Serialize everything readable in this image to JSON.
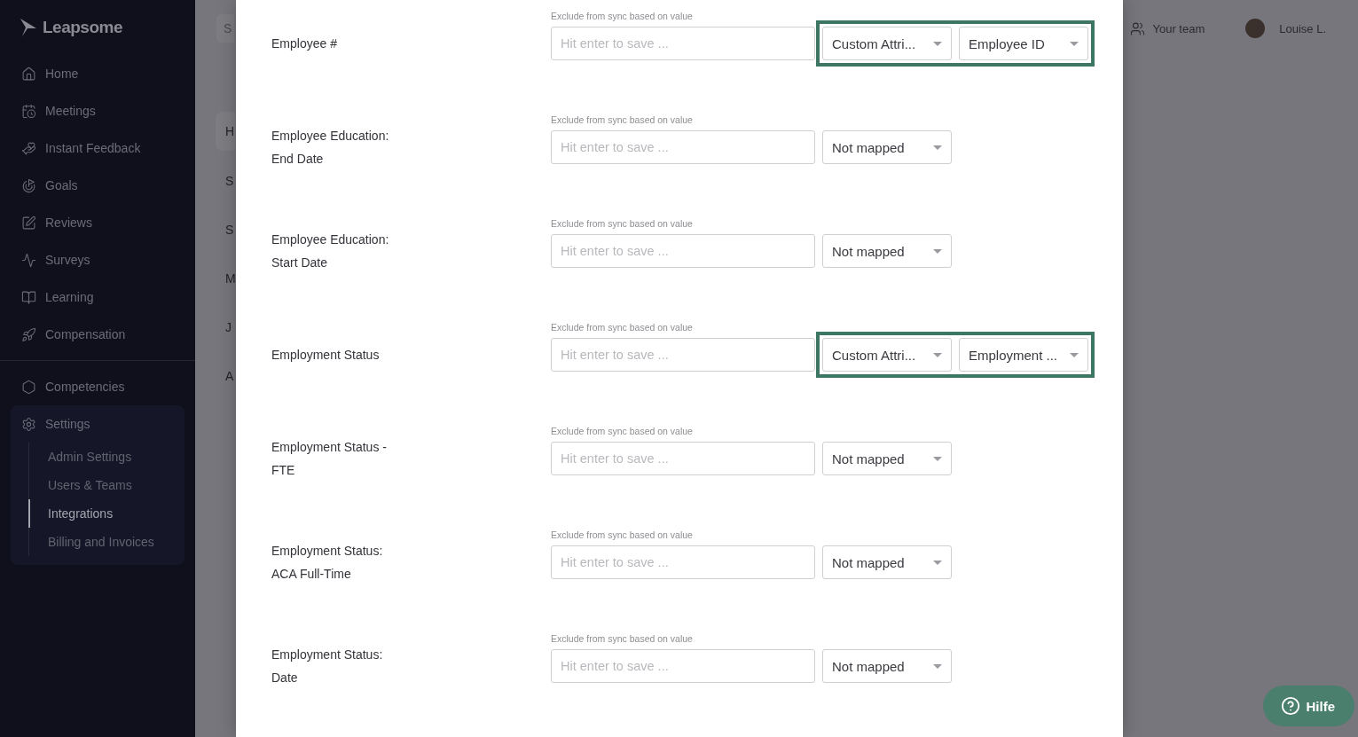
{
  "sidebar": {
    "logo": "Leapsome",
    "items": [
      {
        "label": "Home"
      },
      {
        "label": "Meetings"
      },
      {
        "label": "Instant Feedback"
      },
      {
        "label": "Goals"
      },
      {
        "label": "Reviews"
      },
      {
        "label": "Surveys"
      },
      {
        "label": "Learning"
      },
      {
        "label": "Compensation"
      }
    ],
    "secondary_items": [
      {
        "label": "Competencies"
      }
    ],
    "settings": {
      "label": "Settings",
      "expanded": true,
      "children": [
        {
          "label": "Admin Settings",
          "selected": false
        },
        {
          "label": "Users & Teams",
          "selected": false
        },
        {
          "label": "Integrations",
          "selected": true
        },
        {
          "label": "Billing and Invoices",
          "selected": false
        }
      ]
    }
  },
  "background": {
    "search_fragment": "S",
    "tab_fragment": "H",
    "list_fragments": [
      "S",
      "S",
      "M",
      "J",
      "A"
    ],
    "team_link": "Your team",
    "user_name": "Louise L."
  },
  "modal": {
    "rows": [
      {
        "label_lines": [
          "Employee #"
        ],
        "caption": "Exclude from sync based on value",
        "placeholder": "Hit enter to save ...",
        "mappings": [
          "Custom Attri...",
          "Employee ID"
        ],
        "highlighted": true
      },
      {
        "label_lines": [
          "Employee Education:",
          "End Date"
        ],
        "caption": "Exclude from sync based on value",
        "placeholder": "Hit enter to save ...",
        "mappings": [
          "Not mapped"
        ],
        "highlighted": false
      },
      {
        "label_lines": [
          "Employee Education:",
          "Start Date"
        ],
        "caption": "Exclude from sync based on value",
        "placeholder": "Hit enter to save ...",
        "mappings": [
          "Not mapped"
        ],
        "highlighted": false
      },
      {
        "label_lines": [
          "Employment Status"
        ],
        "caption": "Exclude from sync based on value",
        "placeholder": "Hit enter to save ...",
        "mappings": [
          "Custom Attri...",
          "Employment ..."
        ],
        "highlighted": true
      },
      {
        "label_lines": [
          "Employment Status -",
          "FTE"
        ],
        "caption": "Exclude from sync based on value",
        "placeholder": "Hit enter to save ...",
        "mappings": [
          "Not mapped"
        ],
        "highlighted": false
      },
      {
        "label_lines": [
          "Employment Status:",
          "ACA Full-Time"
        ],
        "caption": "Exclude from sync based on value",
        "placeholder": "Hit enter to save ...",
        "mappings": [
          "Not mapped"
        ],
        "highlighted": false
      },
      {
        "label_lines": [
          "Employment Status:",
          "Date"
        ],
        "caption": "Exclude from sync based on value",
        "placeholder": "Hit enter to save ...",
        "mappings": [
          "Not mapped"
        ],
        "highlighted": false
      }
    ]
  },
  "help_button": {
    "label": "Hilfe"
  }
}
